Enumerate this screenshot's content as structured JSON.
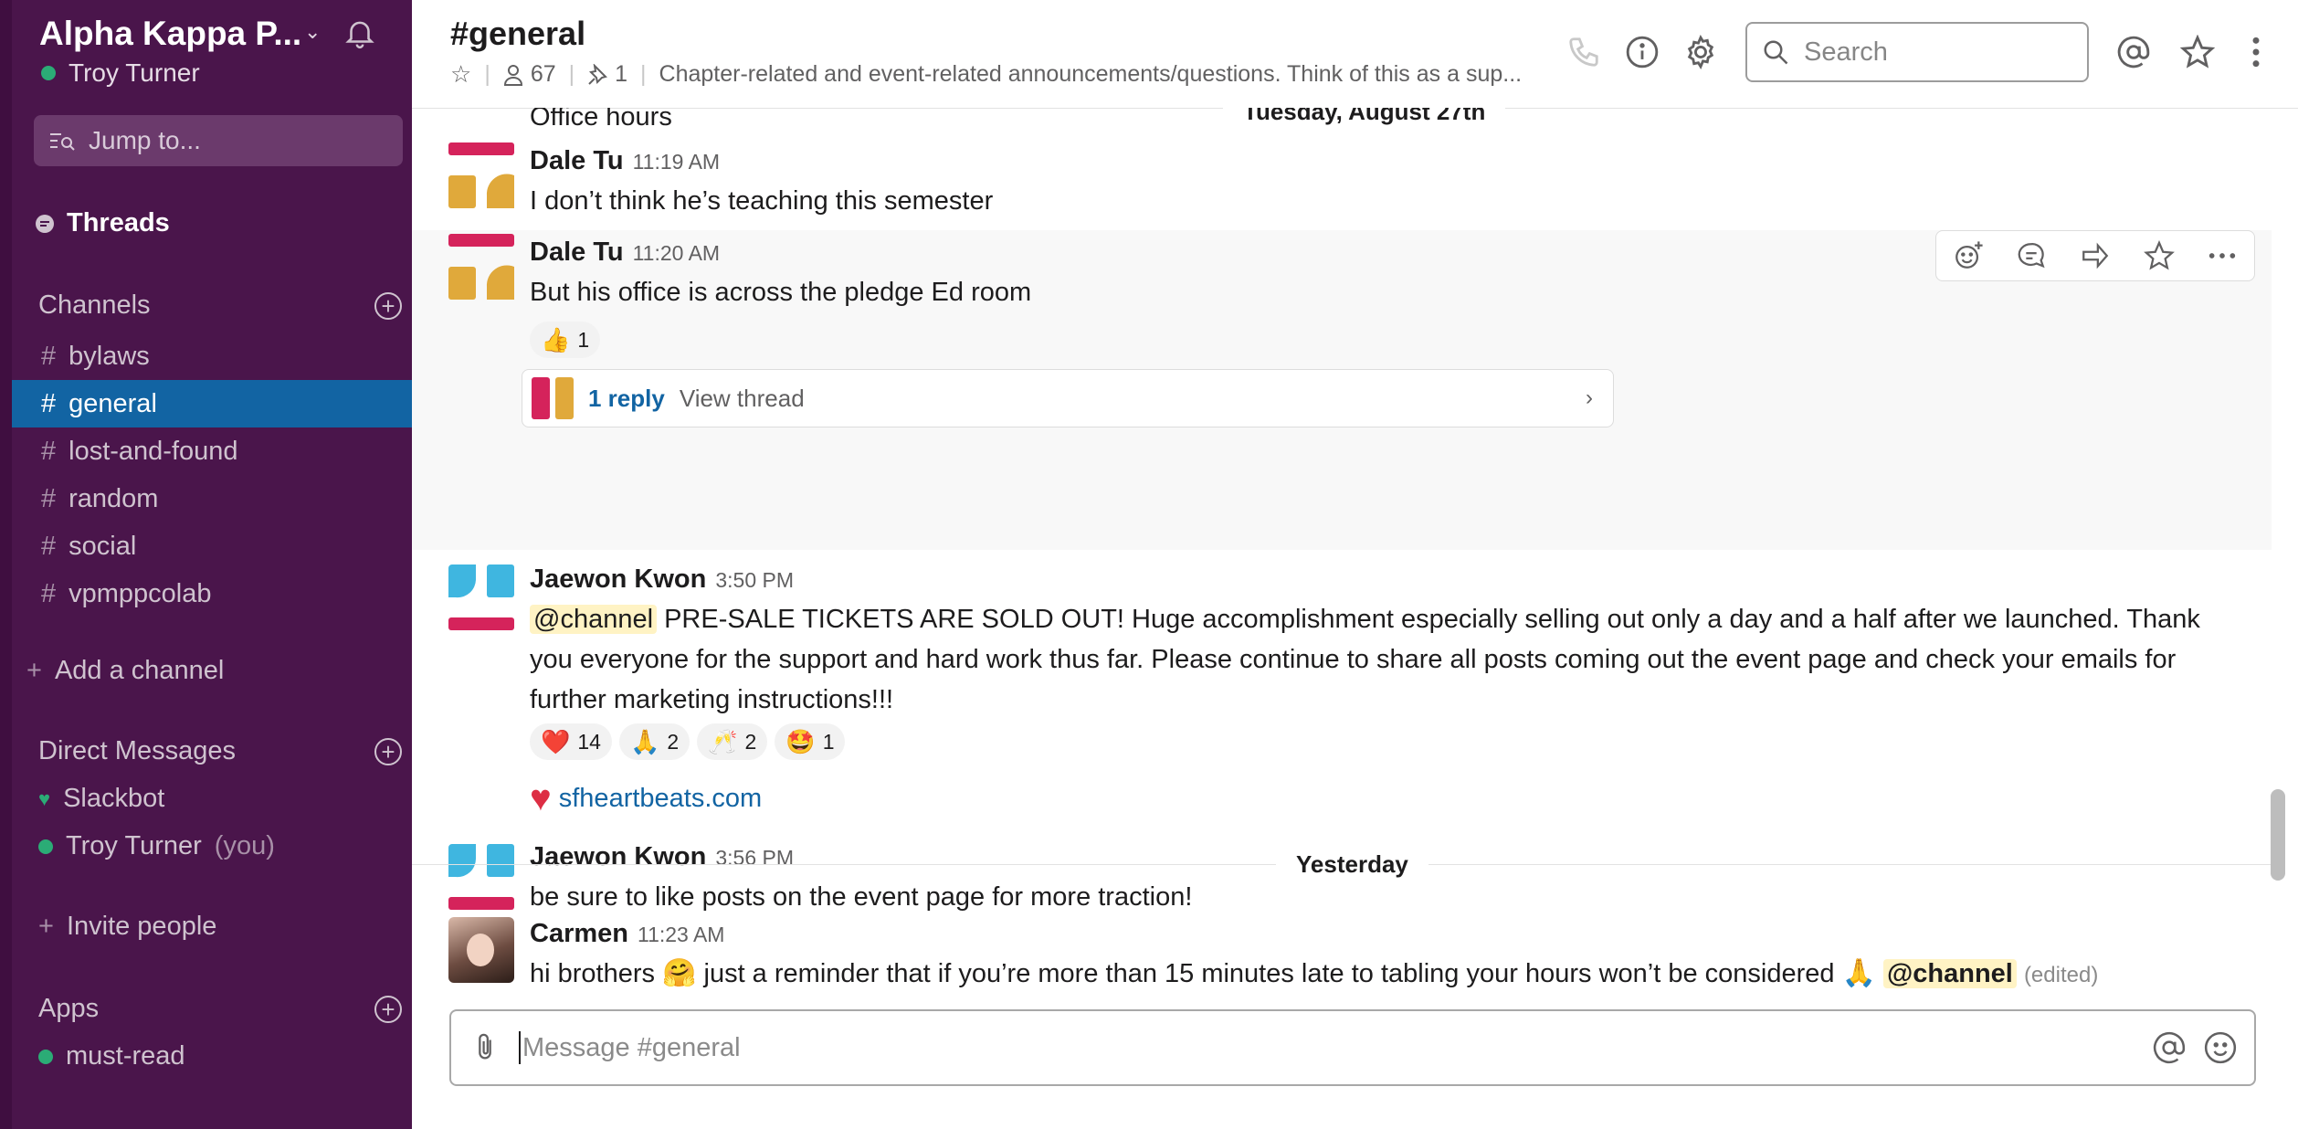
{
  "workspace": {
    "name": "Alpha Kappa P...",
    "user": "Troy Turner"
  },
  "sidebar": {
    "jump_label": "Jump to...",
    "threads_label": "Threads",
    "channels_heading": "Channels",
    "channels": [
      {
        "name": "bylaws"
      },
      {
        "name": "general"
      },
      {
        "name": "lost-and-found"
      },
      {
        "name": "random"
      },
      {
        "name": "social"
      },
      {
        "name": "vpmppcolab"
      }
    ],
    "add_channel": "Add a channel",
    "dm_heading": "Direct Messages",
    "dms": [
      {
        "name": "Slackbot",
        "suffix": ""
      },
      {
        "name": "Troy Turner",
        "suffix": "(you)"
      }
    ],
    "invite": "Invite people",
    "apps_heading": "Apps",
    "apps": [
      {
        "name": "must-read"
      }
    ]
  },
  "header": {
    "title": "#general",
    "members": "67",
    "pins": "1",
    "topic": "Chapter-related and event-related announcements/questions. Think of this as a sup...",
    "search_placeholder": "Search"
  },
  "messages": {
    "date1": "Tuesday, August 27th",
    "prev_text": "Office hours",
    "m1": {
      "user": "Dale Tu",
      "time": "11:19 AM",
      "text": "I don’t think he’s teaching this semester"
    },
    "m2": {
      "user": "Dale Tu",
      "time": "11:20 AM",
      "text": "But his office is across the pledge Ed room",
      "reaction_count": "1",
      "reply_label": "1 reply",
      "view_thread": "View thread"
    },
    "m3": {
      "user": "Jaewon Kwon",
      "time": "3:50 PM",
      "mention": "@channel",
      "text": "PRE-SALE TICKETS ARE SOLD OUT! Huge accomplishment especially selling out only a day and a half after we launched. Thank you everyone for the support and hard work thus far. Please continue to share all posts coming out the event page and check your emails for further marketing instructions!!!",
      "reactions": [
        {
          "emoji": "❤️",
          "count": "14"
        },
        {
          "emoji": "🙏",
          "count": "2"
        },
        {
          "emoji": "🥂",
          "count": "2"
        },
        {
          "emoji": "🤩",
          "count": "1"
        }
      ],
      "link": "sfheartbeats.com"
    },
    "m4": {
      "user": "Jaewon Kwon",
      "time": "3:56 PM",
      "text": "be sure to like posts on the event page for more traction!"
    },
    "date2": "Yesterday",
    "m5": {
      "user": "Carmen",
      "time": "11:23 AM",
      "text_a": "hi brothers",
      "text_b": "just a reminder that if you’re more than 15 minutes late to tabling your hours won’t be considered",
      "mention": "@channel",
      "edited": "(edited)"
    }
  },
  "composer": {
    "placeholder": "Message #general"
  },
  "colors": {
    "sidebar": "#4a154b",
    "active": "#1264a3",
    "link": "#1264a3",
    "presence": "#2bac76"
  }
}
